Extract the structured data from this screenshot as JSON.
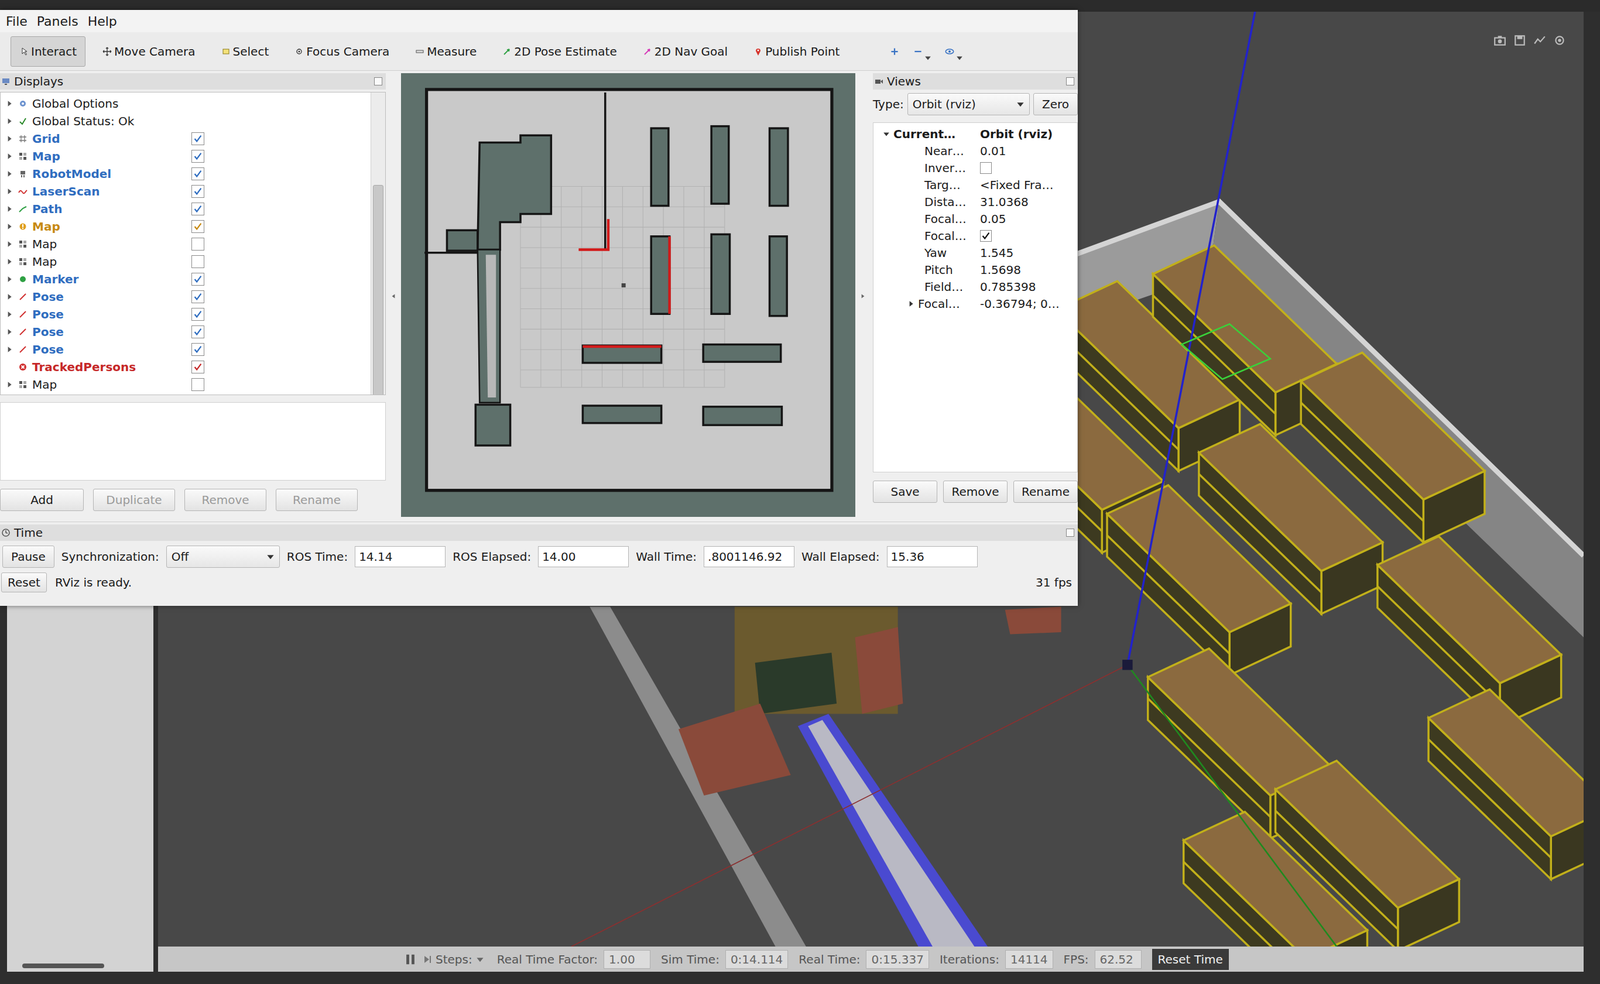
{
  "rviz": {
    "menu": [
      "File",
      "Panels",
      "Help"
    ],
    "tools": [
      {
        "label": "Interact",
        "kind": "interact",
        "selected": true
      },
      {
        "label": "Move Camera",
        "kind": "move",
        "selected": false
      },
      {
        "label": "Select",
        "kind": "select",
        "selected": false
      },
      {
        "label": "Focus Camera",
        "kind": "focus",
        "selected": false
      },
      {
        "label": "Measure",
        "kind": "measure",
        "selected": false
      },
      {
        "label": "2D Pose Estimate",
        "kind": "pose",
        "selected": false
      },
      {
        "label": "2D Nav Goal",
        "kind": "goal",
        "selected": false
      },
      {
        "label": "Publish Point",
        "kind": "point",
        "selected": false
      }
    ],
    "displays": {
      "title": "Displays",
      "items": [
        {
          "name": "Global Options",
          "kind": "options",
          "has_checkbox": false,
          "checked": false,
          "expandable": true,
          "color": "#1a1a1a"
        },
        {
          "name": "Global Status: Ok",
          "kind": "status",
          "has_checkbox": false,
          "checked": false,
          "expandable": true,
          "color": "#1a1a1a"
        },
        {
          "name": "Grid",
          "kind": "grid",
          "has_checkbox": true,
          "checked": true,
          "expandable": true,
          "color": "#2f6dc0"
        },
        {
          "name": "Map",
          "kind": "map",
          "has_checkbox": true,
          "checked": true,
          "expandable": true,
          "color": "#2f6dc0"
        },
        {
          "name": "RobotModel",
          "kind": "robot",
          "has_checkbox": true,
          "checked": true,
          "expandable": true,
          "color": "#2f6dc0"
        },
        {
          "name": "LaserScan",
          "kind": "laser",
          "has_checkbox": true,
          "checked": true,
          "expandable": true,
          "color": "#2f6dc0"
        },
        {
          "name": "Path",
          "kind": "path",
          "has_checkbox": true,
          "checked": true,
          "expandable": true,
          "color": "#2f6dc0"
        },
        {
          "name": "Map",
          "kind": "warning",
          "has_checkbox": true,
          "checked": true,
          "expandable": true,
          "color": "#c78a12"
        },
        {
          "name": "Map",
          "kind": "map",
          "has_checkbox": true,
          "checked": false,
          "expandable": true,
          "color": "#1a1a1a"
        },
        {
          "name": "Map",
          "kind": "map",
          "has_checkbox": true,
          "checked": false,
          "expandable": true,
          "color": "#1a1a1a"
        },
        {
          "name": "Marker",
          "kind": "marker",
          "has_checkbox": true,
          "checked": true,
          "expandable": true,
          "color": "#2f6dc0"
        },
        {
          "name": "Pose",
          "kind": "pose",
          "has_checkbox": true,
          "checked": true,
          "expandable": true,
          "color": "#2f6dc0"
        },
        {
          "name": "Pose",
          "kind": "pose",
          "has_checkbox": true,
          "checked": true,
          "expandable": true,
          "color": "#2f6dc0"
        },
        {
          "name": "Pose",
          "kind": "pose",
          "has_checkbox": true,
          "checked": true,
          "expandable": true,
          "color": "#2f6dc0"
        },
        {
          "name": "Pose",
          "kind": "pose",
          "has_checkbox": true,
          "checked": true,
          "expandable": true,
          "color": "#2f6dc0"
        },
        {
          "name": "TrackedPersons",
          "kind": "error",
          "has_checkbox": true,
          "checked": true,
          "expandable": false,
          "color": "#c62828"
        },
        {
          "name": "Map",
          "kind": "map",
          "has_checkbox": true,
          "checked": false,
          "expandable": true,
          "color": "#1a1a1a"
        }
      ],
      "buttons": [
        {
          "label": "Add",
          "disabled": false
        },
        {
          "label": "Duplicate",
          "disabled": true
        },
        {
          "label": "Remove",
          "disabled": true
        },
        {
          "label": "Rename",
          "disabled": true
        }
      ]
    },
    "views": {
      "title": "Views",
      "type_label": "Type:",
      "type_value": "Orbit (rviz)",
      "zero": "Zero",
      "props": [
        {
          "name": "Current…",
          "kind": "header",
          "value": "Orbit (rviz)",
          "expanded": true
        },
        {
          "name": "Near…",
          "kind": "text",
          "value": "0.01"
        },
        {
          "name": "Inver…",
          "kind": "check",
          "checked": false
        },
        {
          "name": "Targ…",
          "kind": "text",
          "value": "<Fixed Fra…"
        },
        {
          "name": "Dista…",
          "kind": "text",
          "value": "31.0368"
        },
        {
          "name": "Focal…",
          "kind": "text",
          "value": "0.05"
        },
        {
          "name": "Focal…",
          "kind": "check",
          "checked": true
        },
        {
          "name": "Yaw",
          "kind": "text",
          "value": "1.545"
        },
        {
          "name": "Pitch",
          "kind": "text",
          "value": "1.5698"
        },
        {
          "name": "Field…",
          "kind": "text",
          "value": "0.785398"
        },
        {
          "name": "Focal…",
          "kind": "group",
          "value": "-0.36794; 0…",
          "expanded": false
        }
      ],
      "buttons": [
        "Save",
        "Remove",
        "Rename"
      ]
    },
    "time": {
      "title": "Time",
      "pause": "Pause",
      "sync_label": "Synchronization:",
      "sync_value": "Off",
      "fields": [
        {
          "label": "ROS Time:",
          "value": "14.14"
        },
        {
          "label": "ROS Elapsed:",
          "value": "14.00"
        },
        {
          "label": "Wall Time:",
          "value": ".8001146.92"
        },
        {
          "label": "Wall Elapsed:",
          "value": "15.36"
        }
      ],
      "reset": "Reset",
      "status": "RViz is ready.",
      "fps": "31 fps"
    }
  },
  "gazebo": {
    "steps": "Steps:",
    "fields": [
      {
        "label": "Real Time Factor:",
        "value": "1.00"
      },
      {
        "label": "Sim Time:",
        "value": "0:14.114"
      },
      {
        "label": "Real Time:",
        "value": "0:15.337"
      },
      {
        "label": "Iterations:",
        "value": "14114"
      },
      {
        "label": "FPS:",
        "value": "62.52"
      }
    ],
    "reset": "Reset Time"
  }
}
